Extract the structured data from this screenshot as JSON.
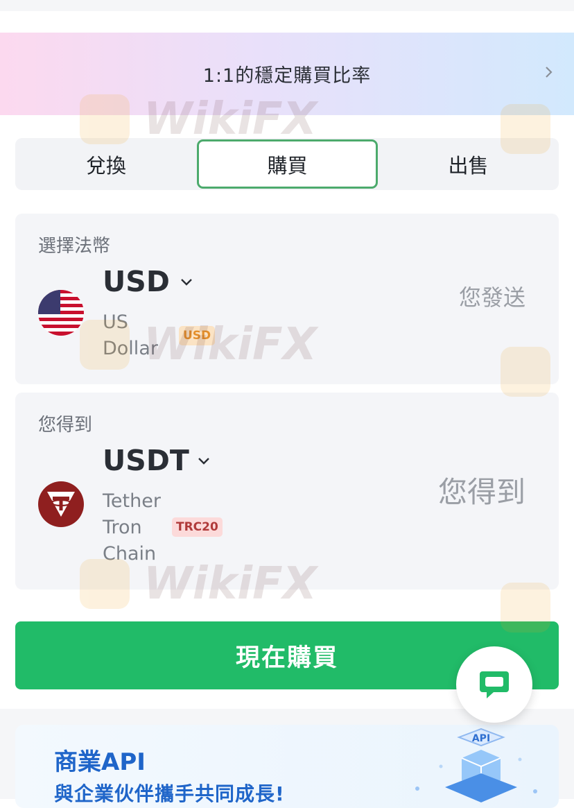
{
  "banner": {
    "text": "1:1的穩定購買比率"
  },
  "tabs": [
    {
      "label": "兌換"
    },
    {
      "label": "購買",
      "active": true
    },
    {
      "label": "出售"
    }
  ],
  "fiat": {
    "label": "選擇法幣",
    "code": "USD",
    "name_line1": "US",
    "name_line2": "Dollar",
    "badge": "USD",
    "amount_placeholder": "您發送",
    "icon": "us-flag-icon"
  },
  "crypto": {
    "label": "您得到",
    "code": "USDT",
    "name_line1": "Tether",
    "name_line2": "Tron",
    "name_line3": "Chain",
    "badge": "TRC20",
    "amount_placeholder": "您得到",
    "icon": "tether-icon"
  },
  "buy_button": {
    "label": "現在購買"
  },
  "chat": {
    "icon": "chat-icon"
  },
  "promo": {
    "title": "商業API",
    "subtitle": "與企業伙伴攜手共同成長!",
    "art_label": "API"
  },
  "watermark": {
    "text": "WikiFX"
  },
  "colors": {
    "primary_green": "#21bb68",
    "active_tab_border": "#4caa6c",
    "usd_badge_bg": "#fbe3c4",
    "trc_badge_bg": "#fcdada",
    "promo_blue": "#1f65c9",
    "tether_red": "#8f1f1f"
  }
}
